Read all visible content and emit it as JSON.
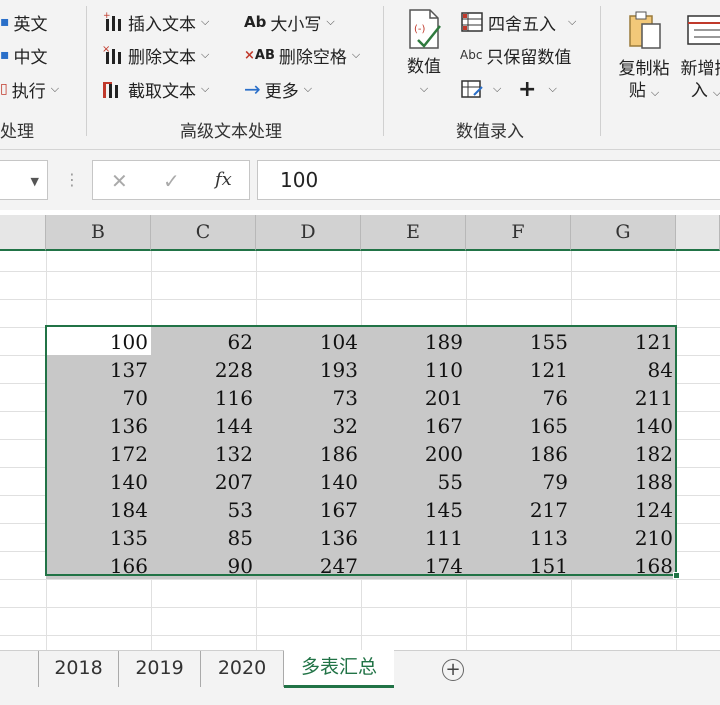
{
  "ribbon": {
    "left_group": {
      "items": [
        "英文",
        "中文",
        "执行"
      ],
      "label": "处理"
    },
    "text_group": {
      "insert_text": "插入文本",
      "delete_text": "删除文本",
      "extract_text": "截取文本",
      "case": "大小写",
      "delete_spaces": "删除空格",
      "more": "更多",
      "label": "高级文本处理",
      "case_icon_text": "Ab",
      "delete_spaces_icon_text": "AB"
    },
    "number_group": {
      "number_btn": "数值",
      "round": "四舍五入",
      "keep_numbers": "只保留数值",
      "keep_numbers_icon_text": "Abc",
      "label": "数值录入"
    },
    "right_group": {
      "copy_paste_1": "复制粘",
      "copy_paste_2": "贴",
      "new_insert_1": "新增插",
      "new_insert_2": "入"
    }
  },
  "formula_bar": {
    "cancel_icon": "✕",
    "confirm_icon": "✓",
    "fx": "fx",
    "value": "100"
  },
  "columns": [
    "B",
    "C",
    "D",
    "E",
    "F",
    "G"
  ],
  "table": {
    "rows": [
      [
        "100",
        "62",
        "104",
        "189",
        "155",
        "121"
      ],
      [
        "137",
        "228",
        "193",
        "110",
        "121",
        "84"
      ],
      [
        "70",
        "116",
        "73",
        "201",
        "76",
        "211"
      ],
      [
        "136",
        "144",
        "32",
        "167",
        "165",
        "140"
      ],
      [
        "172",
        "132",
        "186",
        "200",
        "186",
        "182"
      ],
      [
        "140",
        "207",
        "140",
        "55",
        "79",
        "188"
      ],
      [
        "184",
        "53",
        "167",
        "145",
        "217",
        "124"
      ],
      [
        "135",
        "85",
        "136",
        "111",
        "113",
        "210"
      ],
      [
        "166",
        "90",
        "247",
        "174",
        "151",
        "168"
      ]
    ]
  },
  "sheet_tabs": [
    "2018",
    "2019",
    "2020",
    "多表汇总"
  ],
  "add_sheet": "+",
  "colors": {
    "accent": "#217346",
    "selection": "#c8c8c8",
    "ribbon_bg": "#f3f3f3"
  }
}
